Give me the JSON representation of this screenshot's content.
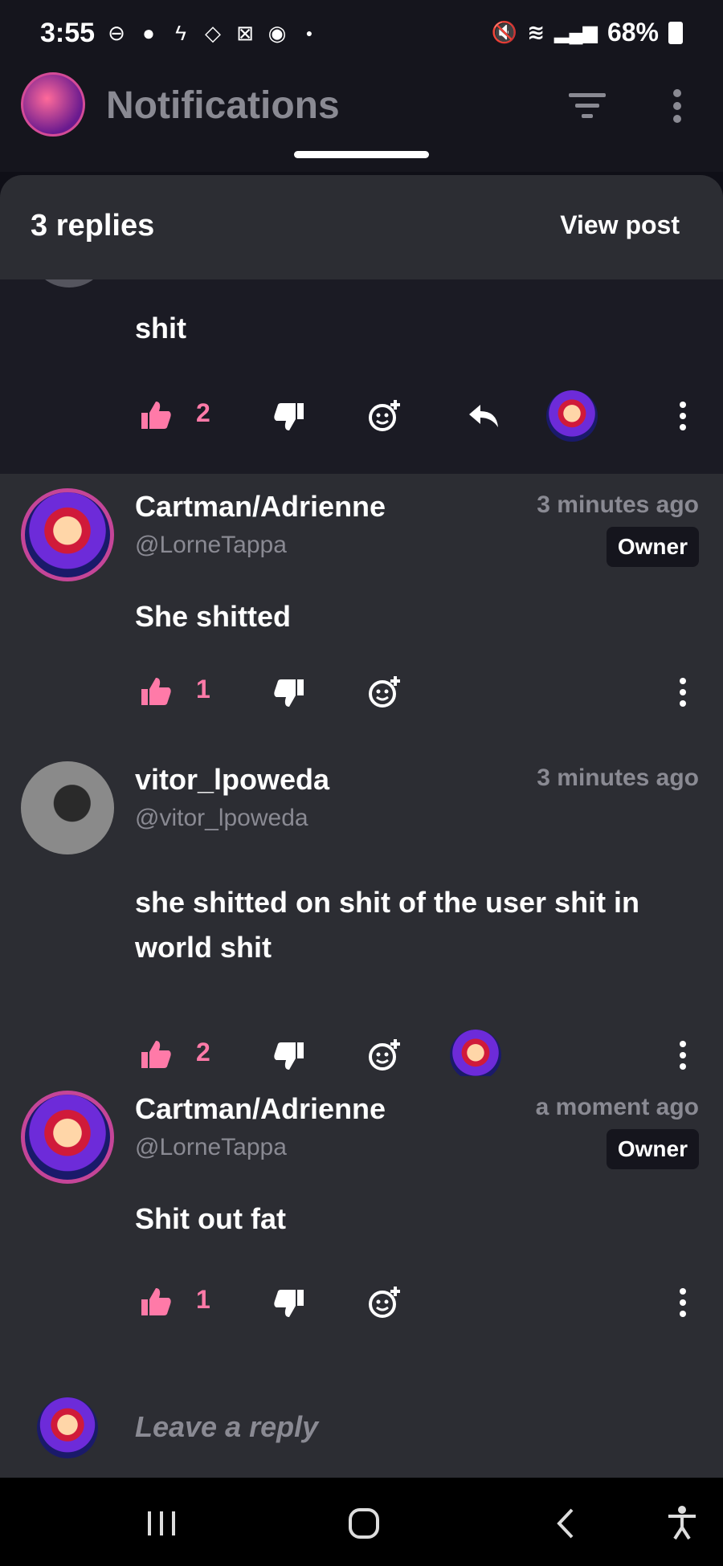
{
  "status_bar": {
    "time": "3:55",
    "battery": "68%"
  },
  "header": {
    "title": "Notifications"
  },
  "sheet": {
    "replies_count": "3 replies",
    "view_post": "View post"
  },
  "partial_comment": {
    "body": "shit",
    "likes": "2"
  },
  "comments": [
    {
      "username": "Cartman/Adrienne",
      "handle": "@LorneTappa",
      "timestamp": "3 minutes ago",
      "badge": "Owner",
      "body": "She shitted",
      "likes": "1"
    },
    {
      "username": "vitor_lpoweda",
      "handle": "@vitor_lpoweda",
      "timestamp": "3 minutes ago",
      "body": "she shitted on shit of the user shit in world shit",
      "likes": "2"
    },
    {
      "username": "Cartman/Adrienne",
      "handle": "@LorneTappa",
      "timestamp": "a moment ago",
      "badge": "Owner",
      "body": "Shit out fat",
      "likes": "1"
    }
  ],
  "reply_bar": {
    "placeholder": "Leave a reply"
  },
  "colors": {
    "accent_pink": "#ff7aa8",
    "background": "#2c2d33",
    "muted_text": "#8a8a93"
  }
}
